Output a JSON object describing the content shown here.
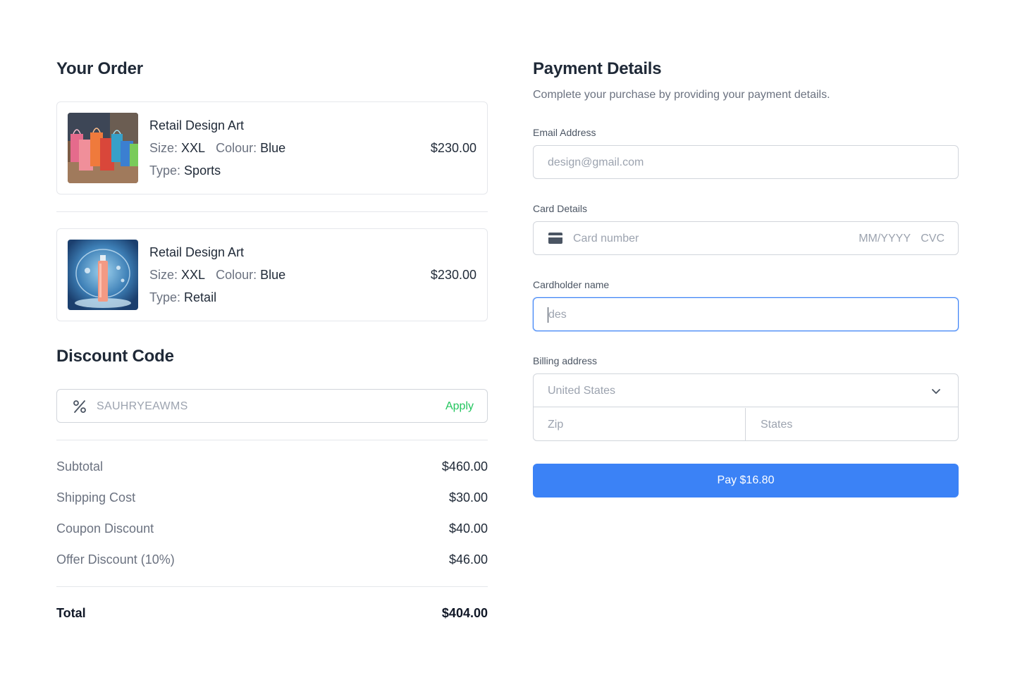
{
  "order": {
    "title": "Your Order",
    "items": [
      {
        "name": "Retail Design Art",
        "size_label": "Size:",
        "size_value": "XXL",
        "colour_label": "Colour:",
        "colour_value": "Blue",
        "type_label": "Type:",
        "type_value": "Sports",
        "price": "$230.00"
      },
      {
        "name": "Retail Design Art",
        "size_label": "Size:",
        "size_value": "XXL",
        "colour_label": "Colour:",
        "colour_value": "Blue",
        "type_label": "Type:",
        "type_value": "Retail",
        "price": "$230.00"
      }
    ]
  },
  "discount": {
    "title": "Discount Code",
    "code": "SAUHRYEAWMS",
    "apply_label": "Apply",
    "icon": "percent-icon"
  },
  "summary": {
    "rows": [
      {
        "label": "Subtotal",
        "value": "$460.00"
      },
      {
        "label": "Shipping Cost",
        "value": "$30.00"
      },
      {
        "label": "Coupon Discount",
        "value": "$40.00"
      },
      {
        "label": "Offer Discount (10%)",
        "value": "$46.00"
      }
    ],
    "total_label": "Total",
    "total_value": "$404.00"
  },
  "payment": {
    "title": "Payment Details",
    "subtitle": "Complete your purchase by providing your payment details.",
    "email_label": "Email Address",
    "email_placeholder": "design@gmail.com",
    "card_label": "Card Details",
    "card_placeholder": "Card number",
    "card_expiry_placeholder": "MM/YYYY",
    "card_cvc_placeholder": "CVC",
    "cardholder_label": "Cardholder name",
    "cardholder_value": "des",
    "billing_label": "Billing address",
    "country_value": "United States",
    "zip_placeholder": "Zip",
    "state_placeholder": "States",
    "pay_button": "Pay $16.80"
  },
  "colors": {
    "accent": "#3b82f6",
    "apply": "#22c55e",
    "border": "#d1d5db"
  }
}
